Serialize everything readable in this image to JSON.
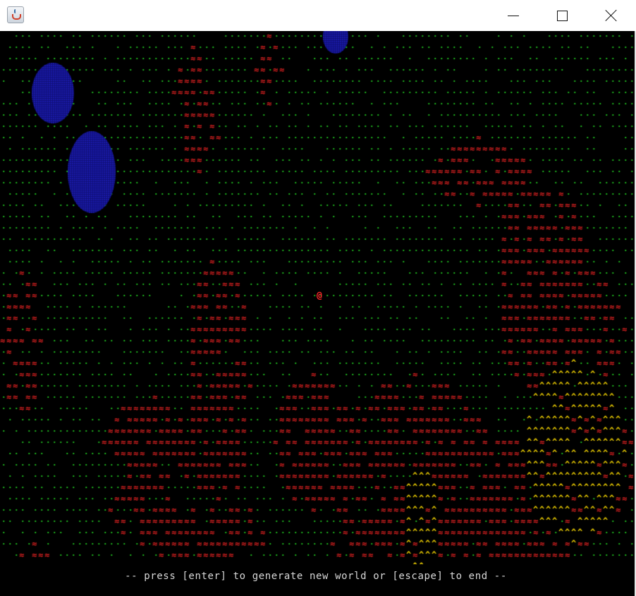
{
  "window": {
    "title": "",
    "app_icon": "java-cup-icon",
    "controls": [
      "minimize-icon",
      "maximize-icon",
      "close-icon"
    ]
  },
  "world": {
    "glyphs": {
      "grass": ".",
      "lava": "≈",
      "mountain": "^",
      "player": "@",
      "water": "▒"
    },
    "colors": {
      "background": "#000000",
      "grass": "#22cc22",
      "lava": "#e02222",
      "mountain": "#f0d000",
      "player": "#ff2a2a",
      "water": "#1a1aa8"
    }
  },
  "status": {
    "message": "-- press [enter] to generate new world or [escape] to end --"
  }
}
